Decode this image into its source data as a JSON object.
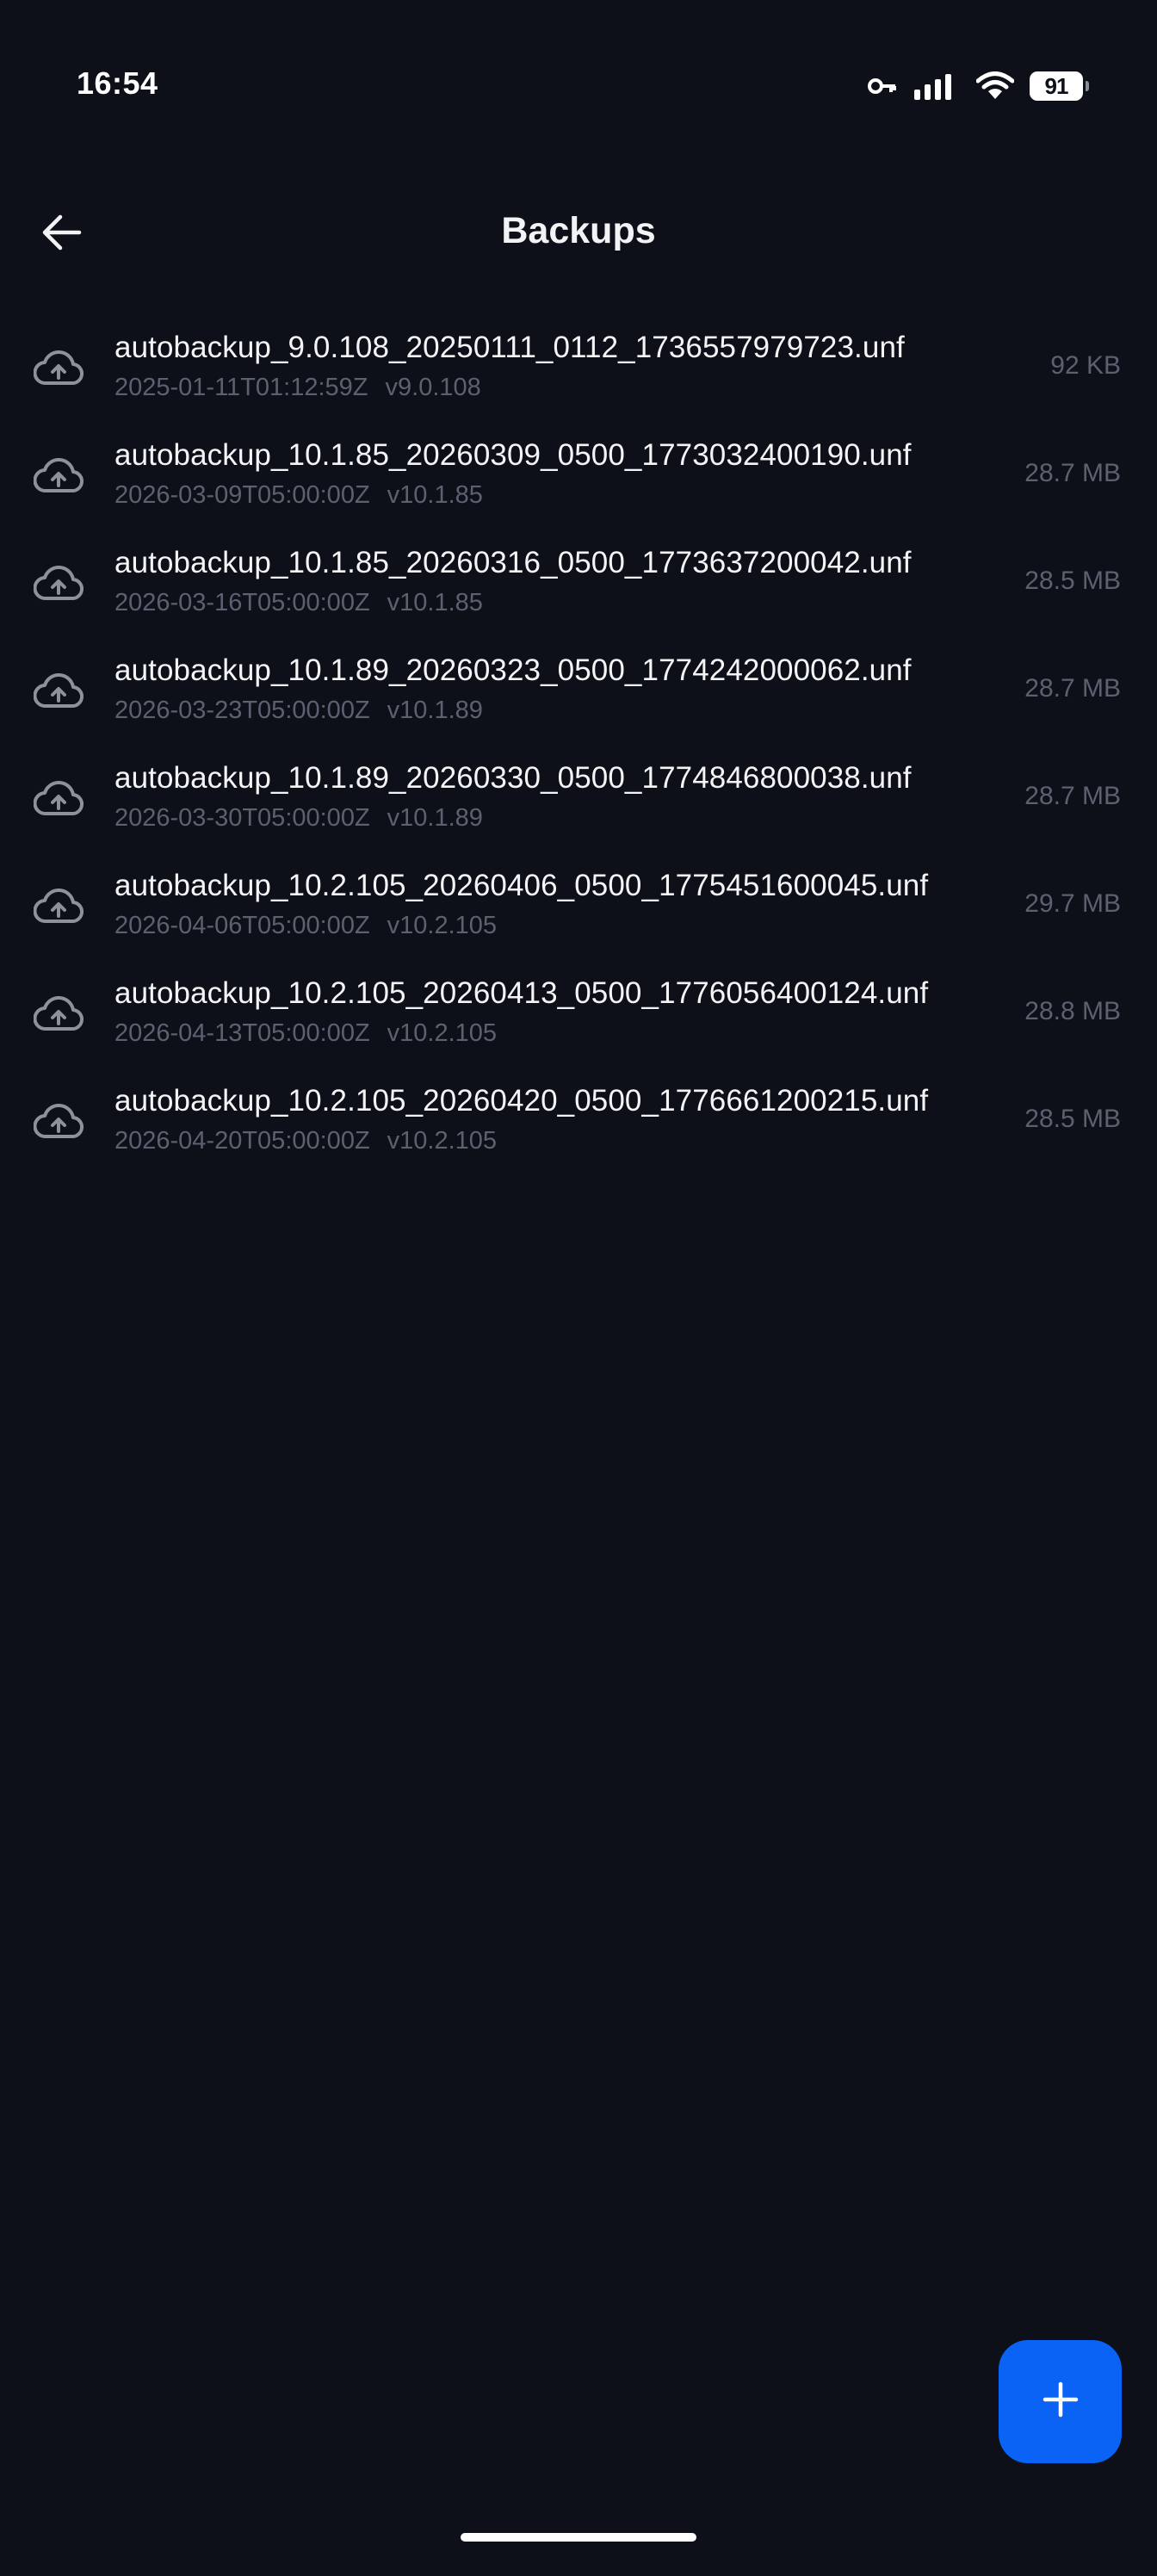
{
  "status_bar": {
    "time": "16:54",
    "battery_level": "91",
    "icons": [
      "vpn-key-icon",
      "signal-icon",
      "wifi-icon",
      "battery-icon"
    ]
  },
  "app_bar": {
    "title": "Backups",
    "back_icon": "arrow-left-icon"
  },
  "backups": [
    {
      "name": "autobackup_9.0.108_20250111_0112_1736557979723.unf",
      "timestamp": "2025-01-11T01:12:59Z",
      "version": "v9.0.108",
      "size": "92 KB"
    },
    {
      "name": "autobackup_10.1.85_20260309_0500_1773032400190.unf",
      "timestamp": "2026-03-09T05:00:00Z",
      "version": "v10.1.85",
      "size": "28.7 MB"
    },
    {
      "name": "autobackup_10.1.85_20260316_0500_1773637200042.unf",
      "timestamp": "2026-03-16T05:00:00Z",
      "version": "v10.1.85",
      "size": "28.5 MB"
    },
    {
      "name": "autobackup_10.1.89_20260323_0500_1774242000062.unf",
      "timestamp": "2026-03-23T05:00:00Z",
      "version": "v10.1.89",
      "size": "28.7 MB"
    },
    {
      "name": "autobackup_10.1.89_20260330_0500_1774846800038.unf",
      "timestamp": "2026-03-30T05:00:00Z",
      "version": "v10.1.89",
      "size": "28.7 MB"
    },
    {
      "name": "autobackup_10.2.105_20260406_0500_1775451600045.unf",
      "timestamp": "2026-04-06T05:00:00Z",
      "version": "v10.2.105",
      "size": "29.7 MB"
    },
    {
      "name": "autobackup_10.2.105_20260413_0500_1776056400124.unf",
      "timestamp": "2026-04-13T05:00:00Z",
      "version": "v10.2.105",
      "size": "28.8 MB"
    },
    {
      "name": "autobackup_10.2.105_20260420_0500_1776661200215.unf",
      "timestamp": "2026-04-20T05:00:00Z",
      "version": "v10.2.105",
      "size": "28.5 MB"
    }
  ],
  "row_icon": "cloud-upload-icon",
  "fab": {
    "icon": "plus-icon"
  },
  "colors": {
    "background": "#0d1018",
    "accent": "#0a63f5",
    "primary_text": "#f3f4f6",
    "secondary_text": "#5b6170"
  }
}
